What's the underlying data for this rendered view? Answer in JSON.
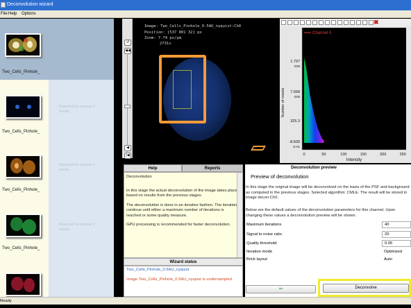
{
  "window": {
    "title": "Deconvolution wizard"
  },
  "menu": [
    "File",
    "Help",
    "Options"
  ],
  "sidebar": {
    "channels": [
      {
        "name": "Two_Cells_Pinhole_",
        "note": "",
        "color": "#d4b24a"
      },
      {
        "name": "Two_Cells_Pinhole_",
        "note": "Reserved for channel 0 results",
        "color": "#2f63c9"
      },
      {
        "name": "Two_Cells_Pinhole_",
        "note": "Reserved for channel 1 results",
        "color": "#d17a19"
      },
      {
        "name": "Two_Cells_Pinhole_",
        "note": "Reserved for channel 2 results",
        "color": "#29b649"
      },
      {
        "name": "Two_Cells_Pinhole_",
        "note": "",
        "color": "#c8203a"
      }
    ]
  },
  "viewer": {
    "image_label": "Image: Two_Cells_Pinhole_0.5AU_nyquist:Ch0",
    "position_label": "Position: [537 801 32] px",
    "zoom_label": "Zoom: 7.74 px/μm",
    "zoom_factor": "2731x"
  },
  "histogram": {
    "legend": "Channel 0",
    "y_axis_label": "Number of voxels",
    "x_axis_label": "Intensity",
    "y_ticks": [
      {
        "mantissa": "1.797",
        "exp": "E09"
      },
      {
        "mantissa": "7.658",
        "exp": "E05"
      },
      {
        "mantissa": "325.3",
        "exp": ""
      },
      {
        "mantissa": "-8.609",
        "exp": "E-01"
      }
    ],
    "x_ticks": [
      "0",
      "50",
      "100",
      "150",
      "200",
      "250"
    ],
    "line_color": "#e03c3c",
    "chart_data": {
      "type": "area",
      "title": "",
      "xlabel": "Intensity",
      "ylabel": "Number of voxels",
      "xlim": [
        0,
        255
      ],
      "series": [
        {
          "name": "Channel 0",
          "x": [
            0,
            5,
            10,
            15,
            20,
            25,
            30,
            35,
            40,
            45,
            50
          ],
          "y": [
            1.797,
            1.6,
            1.3,
            1.0,
            0.8,
            0.6,
            0.45,
            0.3,
            0.2,
            0.1,
            0.05
          ]
        }
      ]
    }
  },
  "help": {
    "tabs": [
      "Help",
      "Reports"
    ],
    "title": "Deconvolution",
    "paragraphs": [
      "In this stage the actual deconvolution of the image takes place, based on results from the previous stages.",
      "The deconvolution is done in an iterative fashion. The iterations continue until either a maximum number of iterations is reached or some quality measure.",
      "GPU processing is recommended for faster deconvolution."
    ]
  },
  "wizard_status": {
    "title": "Wizard status",
    "ok_line": "Two_Cells_Pinhole_0.5AU_nyquist",
    "warn_line": "Image Two_Cells_Pinhole_0.5AU_nyquist is undersampled"
  },
  "deconvolution": {
    "preview_label": "Deconvolution preview",
    "heading": "Preview of deconvolution",
    "description": "In this stage the original image will be deconvolved on the basis of the PSF and background as computed in the previous stages. Selected algorithm: CMLE. The result will be stored in image decon:Ch0.",
    "note": "Below are the default values of the deconvolution parameters for this channel. Upon changing these values a deconvolution preview will be shown.",
    "params": [
      {
        "label": "Maximum iterations",
        "value": "40"
      },
      {
        "label": "Signal to noise ratio",
        "value": "20"
      },
      {
        "label": "Quality threshold",
        "value": "0.05"
      },
      {
        "label": "Iteration mode",
        "value": "Optimized"
      },
      {
        "label": "Brick layout",
        "value": "Auto"
      }
    ],
    "back_label": "⇐",
    "deconvolve_label": "Deconvolve",
    "highlight_color": "#f0ec2a"
  },
  "statusbar": {
    "text": "Ready"
  }
}
